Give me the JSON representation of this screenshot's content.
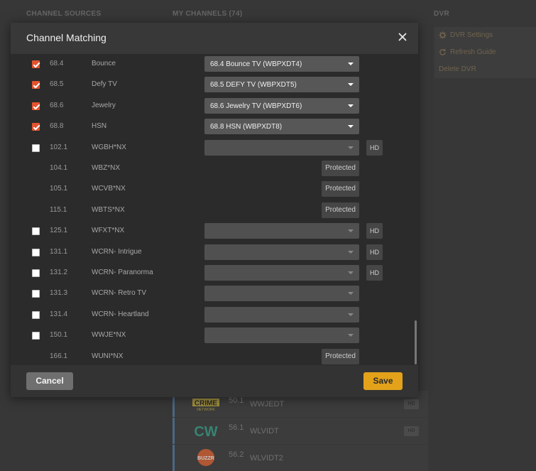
{
  "background": {
    "headings": {
      "channel_sources": "CHANNEL SOURCES",
      "my_channels": "MY CHANNELS (74)",
      "dvr": "DVR"
    },
    "dvr_menu": {
      "settings": "DVR Settings",
      "refresh": "Refresh Guide",
      "delete": "Delete DVR"
    },
    "channel_rows": [
      {
        "logo": "true-crime-network-logo",
        "number": "50.1",
        "callsign": "WWJEDT",
        "badge": "HD"
      },
      {
        "logo": "cw-logo",
        "number": "56.1",
        "callsign": "WLVIDT",
        "badge": "HD"
      },
      {
        "logo": "buzzr-logo",
        "number": "56.2",
        "callsign": "WLVIDT2",
        "badge": ""
      }
    ],
    "logo_texts": {
      "crime": "CRIME",
      "network": "NETWORK",
      "cw": "CW",
      "buzzr": "BUZZR"
    }
  },
  "modal": {
    "title": "Channel Matching",
    "close_icon": "close-icon",
    "rows": [
      {
        "checked": true,
        "number": "68.4",
        "name": "Bounce",
        "kind": "select",
        "value": "68.4 Bounce TV (WBPXDT4)"
      },
      {
        "checked": true,
        "number": "68.5",
        "name": "Defy TV",
        "kind": "select",
        "value": "68.5 DEFY TV (WBPXDT5)"
      },
      {
        "checked": true,
        "number": "68.6",
        "name": "Jewelry",
        "kind": "select",
        "value": "68.6 Jewelry TV (WBPXDT6)"
      },
      {
        "checked": true,
        "number": "68.8",
        "name": "HSN",
        "kind": "select",
        "value": "68.8 HSN (WBPXDT8)"
      },
      {
        "checked": false,
        "number": "102.1",
        "name": "WGBH*NX",
        "kind": "select-hd",
        "value": "",
        "hd": "HD"
      },
      {
        "number": "104.1",
        "name": "WBZ*NX",
        "kind": "protected",
        "label": "Protected"
      },
      {
        "number": "105.1",
        "name": "WCVB*NX",
        "kind": "protected",
        "label": "Protected"
      },
      {
        "number": "115.1",
        "name": "WBTS*NX",
        "kind": "protected",
        "label": "Protected"
      },
      {
        "checked": false,
        "number": "125.1",
        "name": "WFXT*NX",
        "kind": "select-hd",
        "value": "",
        "hd": "HD"
      },
      {
        "checked": false,
        "number": "131.1",
        "name": "WCRN- Intrigue",
        "kind": "select-hd",
        "value": "",
        "hd": "HD"
      },
      {
        "checked": false,
        "number": "131.2",
        "name": "WCRN- Paranorma",
        "kind": "select-hd",
        "value": "",
        "hd": "HD"
      },
      {
        "checked": false,
        "number": "131.3",
        "name": "WCRN- Retro TV",
        "kind": "select",
        "value": ""
      },
      {
        "checked": false,
        "number": "131.4",
        "name": "WCRN- Heartland",
        "kind": "select",
        "value": ""
      },
      {
        "checked": false,
        "number": "150.1",
        "name": "WWJE*NX",
        "kind": "select",
        "value": ""
      },
      {
        "number": "166.1",
        "name": "WUNI*NX",
        "kind": "protected",
        "label": "Protected"
      }
    ],
    "footer": {
      "cancel": "Cancel",
      "save": "Save"
    }
  },
  "colors": {
    "accent_save": "#e3a21a",
    "checkbox_checked": "#e2532f"
  }
}
